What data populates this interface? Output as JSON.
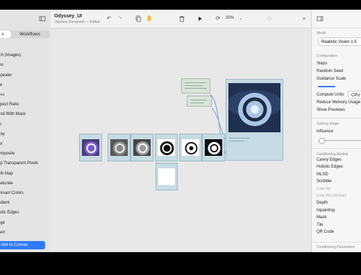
{
  "sidebar": {
    "tabs": [
      "s",
      "Workflows"
    ],
    "items": [
      {
        "label": "y",
        "section": true
      },
      {
        "label": "tch (Images)"
      },
      {
        "label": "tes"
      },
      {
        "label": "epeater"
      },
      {
        "label": "ze"
      },
      {
        "label": "ges",
        "section": true
      },
      {
        "label": "spect Ratio"
      },
      {
        "label": "end With Mask"
      },
      {
        "label": "ur"
      },
      {
        "label": "nny"
      },
      {
        "label": "lor"
      },
      {
        "label": "omposite"
      },
      {
        "label": "op Transparent Pixels"
      },
      {
        "label": "pth Map"
      },
      {
        "label": "saturate"
      },
      {
        "label": "minant Colors"
      },
      {
        "label": "adient"
      },
      {
        "label": "listic Edges"
      },
      {
        "label": "age"
      },
      {
        "label": "vert"
      }
    ],
    "add_button": "Add to Canvas"
  },
  "toolbar": {
    "title": "Odyssey_UI",
    "subtitle": "Odyssey Document — Edited",
    "zoom": "30%"
  },
  "inspector": {
    "model_label": "Model",
    "model_value": "Realistic Vision 1.5",
    "configuration_label": "Configuration",
    "config_items": [
      "Steps",
      "Random Seed",
      "Guidance Scale"
    ],
    "compute_units": "Compute Units",
    "compute_value": "CPU &",
    "config_items2": [
      "Reduce Memory Usage",
      "Show Previews"
    ],
    "starting_label": "Starting image",
    "influence": "Influence",
    "conditioning_label": "Conditioning Models",
    "cond_items": [
      {
        "label": "Canny Edges"
      },
      {
        "label": "Holistic Edges"
      },
      {
        "label": "MLSD"
      },
      {
        "label": "Scribble"
      },
      {
        "label": "Line Art",
        "disabled": true
      },
      {
        "label": "Line Art (Anime)",
        "disabled": true
      },
      {
        "label": "Depth"
      },
      {
        "label": "Inpainting"
      },
      {
        "label": "Mask"
      },
      {
        "label": "Tile"
      },
      {
        "label": "QR Code"
      }
    ],
    "params_label": "Conditioning Parameters"
  }
}
